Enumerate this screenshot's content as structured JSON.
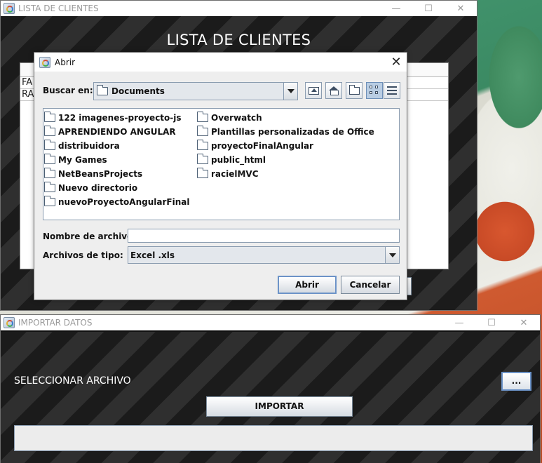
{
  "lista_window": {
    "title": "LISTA DE CLIENTES",
    "heading": "LISTA DE CLIENTES",
    "rows": [
      "FA",
      "RA"
    ]
  },
  "importar_window": {
    "title": "IMPORTAR DATOS",
    "select_label": "SELECCIONAR ARCHIVO",
    "browse_label": "...",
    "import_label": "IMPORTAR"
  },
  "dialog": {
    "title": "Abrir",
    "close_glyph": "✕",
    "look_in_label": "Buscar en:",
    "look_in_value": "Documents",
    "files_col1": [
      "122 imagenes-proyecto-js",
      "APRENDIENDO ANGULAR",
      "distribuidora",
      "My Games",
      "NetBeansProjects",
      "Nuevo directorio",
      "nuevoProyectoAngularFinal"
    ],
    "files_col2": [
      "Overwatch",
      "Plantillas personalizadas de Office",
      "proyectoFinalAngular",
      "public_html",
      "racielMVC"
    ],
    "file_name_label": "Nombre de archivo:",
    "file_name_value": "",
    "file_type_label": "Archivos de tipo:",
    "file_type_value": "Excel .xls",
    "open_label": "Abrir",
    "cancel_label": "Cancelar"
  },
  "window_controls": {
    "minimize": "—",
    "maximize": "☐",
    "close": "✕"
  }
}
